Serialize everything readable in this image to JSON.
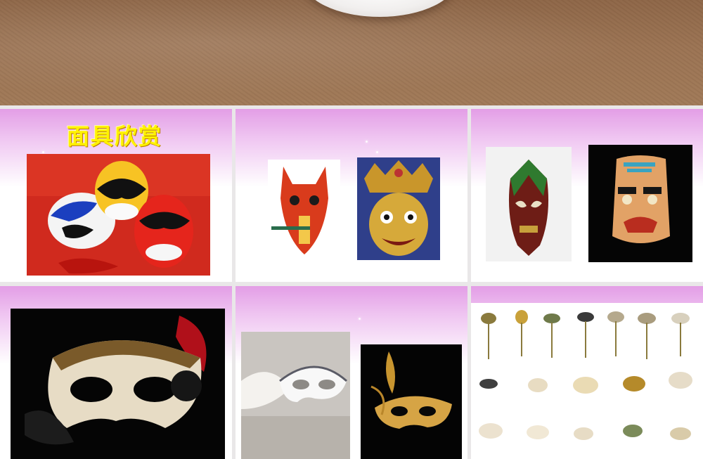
{
  "header": {
    "image": "wood-table-with-white-bowl"
  },
  "slides": [
    {
      "title": "面具欣赏",
      "images": [
        "peking-opera-masks-photo"
      ]
    },
    {
      "images": [
        "red-fox-mask-photo",
        "golden-crowned-demon-mask-photo"
      ]
    },
    {
      "images": [
        "african-wooden-mask-photo",
        "totem-face-mask-photo"
      ]
    },
    {
      "images": [
        "venetian-lace-masquerade-mask-photo"
      ]
    },
    {
      "images": [
        "white-feather-masquerade-mask-photo",
        "gold-filigree-mask-photo"
      ]
    },
    {
      "images": [
        "masquerade-mask-collection-grid"
      ]
    }
  ],
  "colors": {
    "slide_band": "#e39ee6",
    "title": "#fff200",
    "wood": "#9b7353"
  }
}
